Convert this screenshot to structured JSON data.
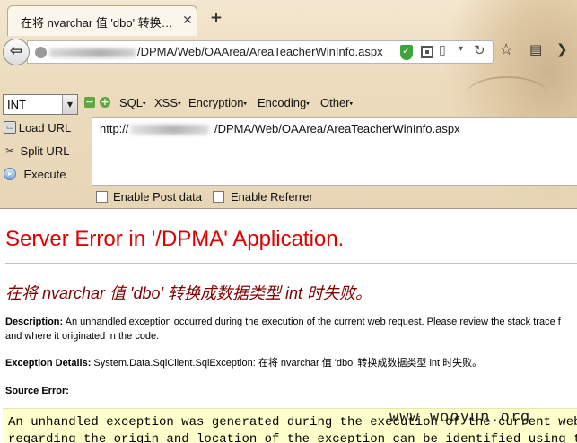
{
  "browser": {
    "tab_title": "在将 nvarchar 值 'dbo' 转换…",
    "tab_close": "✕",
    "new_tab": "+",
    "back": "⇦",
    "url_visible": "/DPMA/Web/OAArea/AreaTeacherWinInfo.aspx",
    "icons": {
      "shield": "shield-icon",
      "qr": "qr-code-icon",
      "reader": "▯",
      "dropdown": "▾",
      "reload": "↻",
      "star": "☆",
      "library": "▤",
      "more": "❯"
    }
  },
  "hackbar": {
    "select_value": "INT",
    "select_arrow": "▼",
    "minus": "−",
    "plus": "+",
    "menus": {
      "sql": "SQL",
      "xss": "XSS",
      "encryption": "Encryption",
      "encoding": "Encoding",
      "other": "Other"
    },
    "menu_caret": "▾",
    "actions": {
      "load_url": "Load URL",
      "split_url": "Split URL",
      "execute": "Execute"
    },
    "action_icons": {
      "load": "▭",
      "split": "✂",
      "execute": "▸"
    },
    "url_prefix": "http://",
    "url_visible": "/DPMA/Web/OAArea/AreaTeacherWinInfo.aspx",
    "enable_post": "Enable Post data",
    "enable_referrer": "Enable Referrer"
  },
  "page": {
    "title": "Server Error in '/DPMA' Application.",
    "subtitle": "在将 nvarchar 值 'dbo' 转换成数据类型 int 时失败。",
    "description_label": "Description:",
    "description_line1": "An unhandled exception occurred during the execution of the current web request. Please review the stack trace f",
    "description_line2": "and where it originated in the code.",
    "exception_label": "Exception Details:",
    "exception_text": "System.Data.SqlClient.SqlException: 在将 nvarchar 值 'dbo' 转换成数据类型 int 时失败。",
    "source_label": "Source Error:",
    "code_line1": "An unhandled exception was generated during the execution of the current web requ",
    "code_line2": "regarding the origin and location of the exception can be identified using the exc",
    "watermark": "www.wooyun.org"
  }
}
